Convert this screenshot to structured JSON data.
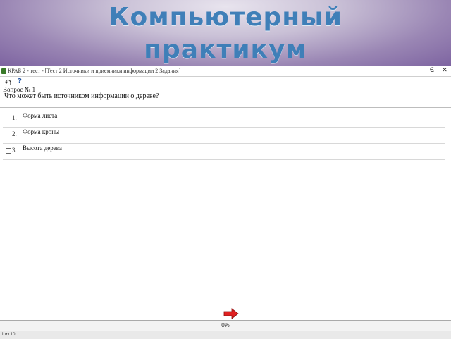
{
  "banner": {
    "title_line1": "Компьютерный",
    "title_line2": "практикум"
  },
  "window": {
    "title": "КРАБ 2 - тест - [Тест 2 Источники и приемники информации 2 Задания]",
    "controls": {
      "restore_icon": "restore-icon",
      "close_icon": "close-icon",
      "close_label": "✕",
      "restore_label": "Є"
    },
    "toolbar": {
      "undo_icon": "undo-icon",
      "help_label": "?"
    }
  },
  "question": {
    "legend": "Вопрос № 1",
    "text": "Что может быть источником информации о дереве?"
  },
  "answers": [
    {
      "num": "1.",
      "text": "Форма листа"
    },
    {
      "num": "2.",
      "text": "Форма кроны"
    },
    {
      "num": "3.",
      "text": "Высота дерева"
    }
  ],
  "progress": {
    "value": 0,
    "label": "0%",
    "color": "#4a8ad4"
  },
  "next_button": {
    "icon": "arrow-right-icon",
    "color": "#e02020"
  },
  "statusbar": {
    "text": "1 из 10"
  }
}
